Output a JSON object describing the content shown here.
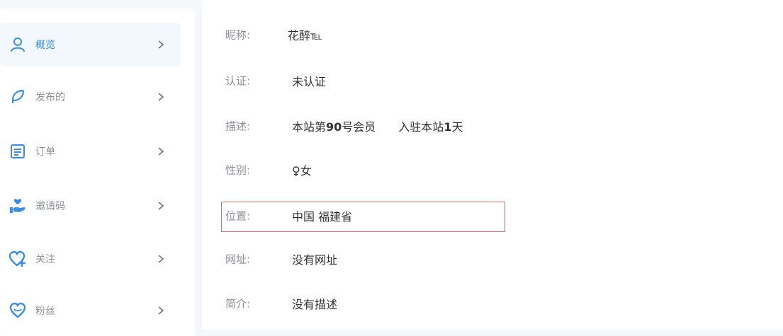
{
  "sidebar": {
    "items": [
      {
        "label": "概览",
        "icon": "user-icon"
      },
      {
        "label": "发布的",
        "icon": "feather-icon"
      },
      {
        "label": "订单",
        "icon": "document-icon"
      },
      {
        "label": "邀请码",
        "icon": "heart-hand-icon"
      },
      {
        "label": "关注",
        "icon": "heart-plus-icon"
      },
      {
        "label": "粉丝",
        "icon": "heart-icon"
      }
    ],
    "accent_color": "#3a8ee6"
  },
  "profile": {
    "nickname_label": "昵称:",
    "nickname_value": "花醉℡",
    "auth_label": "认证:",
    "auth_value": "未认证",
    "desc_label": "描述:",
    "desc_part1": "本站第",
    "desc_member_no": "90",
    "desc_part2": "号会员",
    "desc_part3": "入驻本站",
    "desc_days": "1",
    "desc_part4": "天",
    "gender_label": "性别:",
    "gender_value": "♀女",
    "location_label": "位置:",
    "location_value": "中国 福建省",
    "website_label": "网址:",
    "website_value": "没有网址",
    "intro_label": "简介:",
    "intro_value": "没有描述"
  }
}
